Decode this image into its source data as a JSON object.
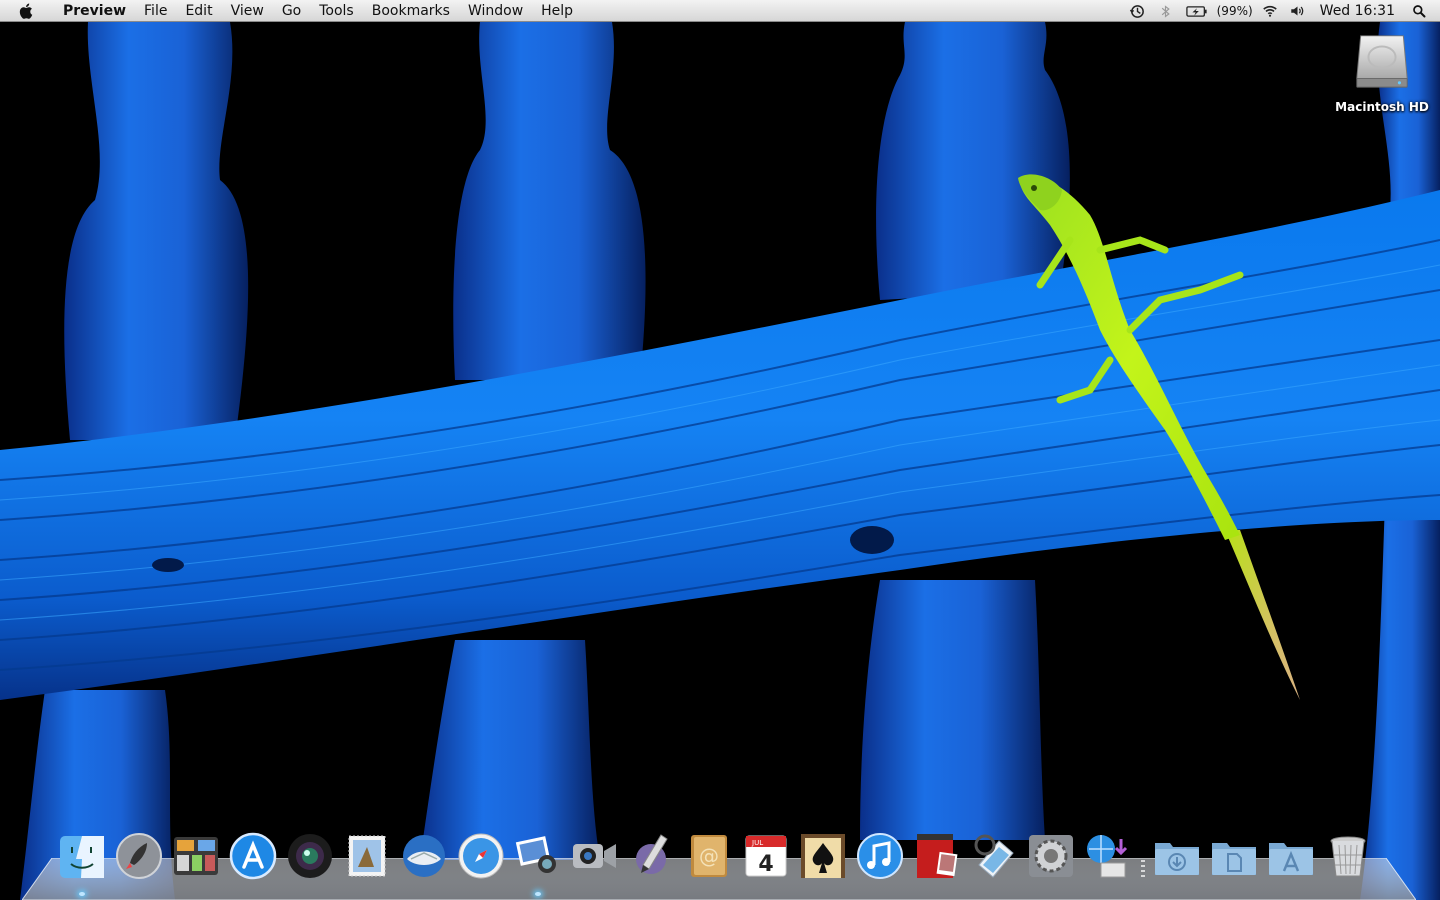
{
  "menubar": {
    "app_name": "Preview",
    "menus": [
      "File",
      "Edit",
      "View",
      "Go",
      "Tools",
      "Bookmarks",
      "Window",
      "Help"
    ],
    "status": {
      "time_machine_icon": "time-machine-icon",
      "bluetooth_icon": "bluetooth-icon",
      "battery_icon": "battery-charging-icon",
      "battery_percent": "(99%)",
      "wifi_icon": "wifi-icon",
      "volume_icon": "volume-icon",
      "clock": "Wed 16:31",
      "spotlight_icon": "spotlight-search-icon"
    }
  },
  "desktop": {
    "icons": [
      {
        "name": "macintosh-hd-icon",
        "label": "Macintosh HD"
      }
    ]
  },
  "dock": {
    "apps": [
      {
        "name": "finder-icon",
        "running": true
      },
      {
        "name": "launchpad-icon",
        "running": false
      },
      {
        "name": "mission-control-icon",
        "running": false
      },
      {
        "name": "app-store-icon",
        "running": false
      },
      {
        "name": "photo-booth-icon",
        "running": false
      },
      {
        "name": "preview-stamp-icon",
        "running": false
      },
      {
        "name": "mail-icon",
        "running": false
      },
      {
        "name": "safari-icon",
        "running": false
      },
      {
        "name": "iphoto-icon",
        "running": true
      },
      {
        "name": "facetime-icon",
        "running": false
      },
      {
        "name": "script-editor-icon",
        "running": false
      },
      {
        "name": "address-book-icon",
        "running": false
      },
      {
        "name": "ical-icon",
        "running": false
      },
      {
        "name": "solitaire-icon",
        "running": false
      },
      {
        "name": "itunes-icon",
        "running": false
      },
      {
        "name": "photo-theater-icon",
        "running": false
      },
      {
        "name": "preview-icon",
        "running": false
      },
      {
        "name": "system-preferences-icon",
        "running": false
      },
      {
        "name": "network-download-icon",
        "running": false
      }
    ],
    "calendar": {
      "month": "JUL",
      "day": "4"
    },
    "folders": [
      {
        "name": "downloads-folder-icon"
      },
      {
        "name": "documents-folder-icon"
      },
      {
        "name": "applications-folder-icon"
      }
    ],
    "trash": {
      "name": "trash-icon"
    }
  },
  "colors": {
    "wood_blue": "#1466d8",
    "lizard_green": "#b6f21c",
    "background": "#000000",
    "menubar": "#e4e4e4"
  }
}
